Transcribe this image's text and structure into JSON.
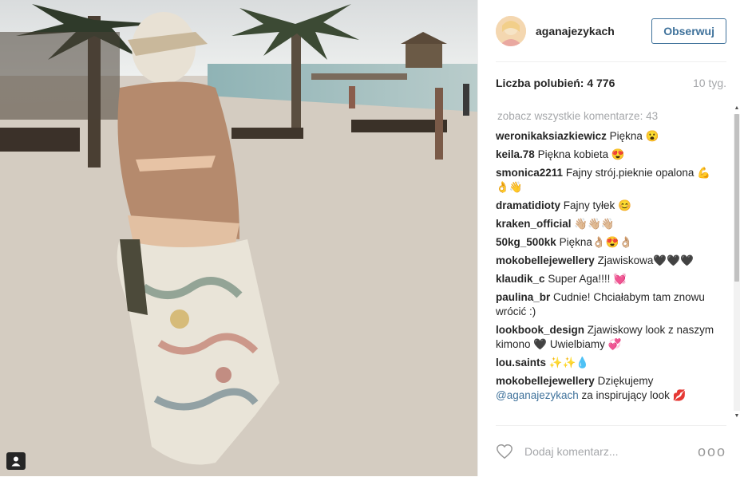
{
  "header": {
    "username": "aganajezykach",
    "follow_label": "Obserwuj"
  },
  "stats": {
    "likes": "Liczba polubień: 4 776",
    "time": "10 tyg."
  },
  "comments": {
    "view_all": "zobacz wszystkie komentarze: 43",
    "items": [
      {
        "user": "weronikaksiazkiewicz",
        "text": "Piękna 😮"
      },
      {
        "user": "keila.78",
        "text": "Piękna kobieta 😍"
      },
      {
        "user": "smonica2211",
        "text": "Fajny strój.pieknie opalona 💪👌👋"
      },
      {
        "user": "dramatidioty",
        "text": "Fajny tyłek 😊"
      },
      {
        "user": "kraken_official",
        "text": "👋🏼👋🏼👋🏼"
      },
      {
        "user": "50kg_500kk",
        "text": "Piękna👌🏼😍👌🏼"
      },
      {
        "user": "mokobellejewellery",
        "text": "Zjawiskowa🖤🖤🖤"
      },
      {
        "user": "klaudik_c",
        "text": "Super Aga!!!! 💓"
      },
      {
        "user": "paulina_br",
        "text": "Cudnie! Chciałabym tam znowu wrócić :)"
      },
      {
        "user": "lookbook_design",
        "text": "Zjawiskowy look z naszym kimono 🖤 Uwielbiamy 💞"
      },
      {
        "user": "lou.saints",
        "text": "✨✨💧"
      },
      {
        "user": "mokobellejewellery",
        "text": "Dziękujemy",
        "mention": "@aganajezykach",
        "text2": "za inspirujący look 💋"
      }
    ]
  },
  "footer": {
    "placeholder": "Dodaj komentarz...",
    "more": "ooo"
  },
  "icons": {
    "heart": "heart-icon",
    "user_tag": "user-tag-icon",
    "more": "more-options-icon"
  },
  "colors": {
    "link": "#3f729b",
    "muted": "#a5a7aa"
  }
}
